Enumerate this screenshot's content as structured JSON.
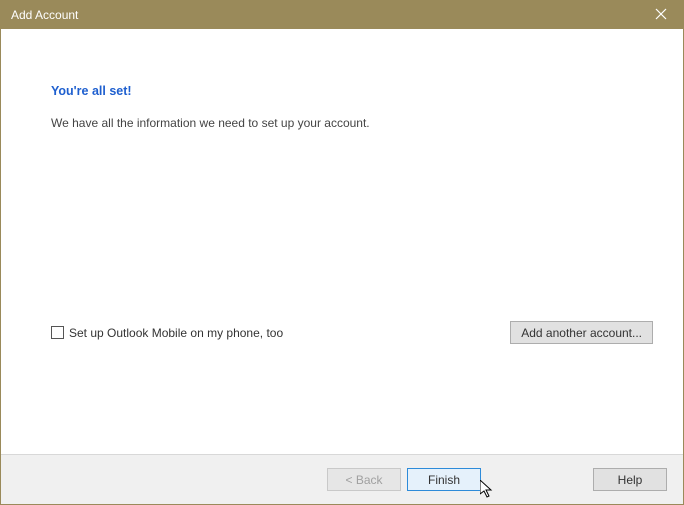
{
  "titlebar": {
    "title": "Add Account"
  },
  "content": {
    "headline": "You're all set!",
    "body": "We have all the information we need to set up your account."
  },
  "lower": {
    "checkbox_label": "Set up Outlook Mobile on my phone, too",
    "add_another": "Add another account..."
  },
  "footer": {
    "back": "< Back",
    "finish": "Finish",
    "help": "Help"
  }
}
